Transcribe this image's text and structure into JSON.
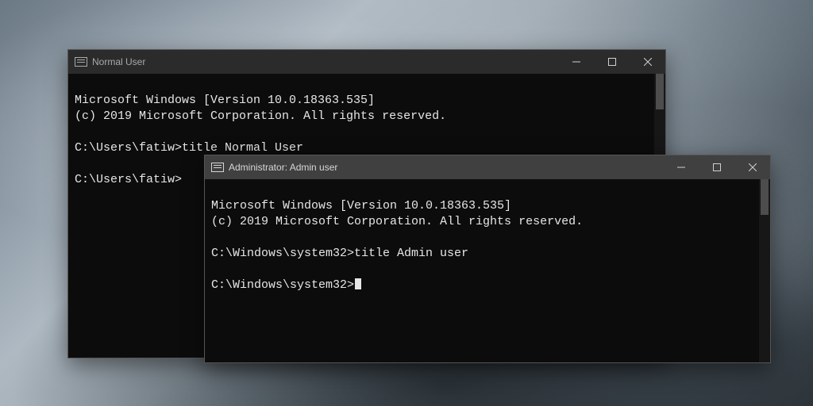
{
  "back_window": {
    "title": "Normal User",
    "lines": {
      "l1": "Microsoft Windows [Version 10.0.18363.535]",
      "l2": "(c) 2019 Microsoft Corporation. All rights reserved.",
      "blank1": "",
      "prompt1": "C:\\Users\\fatiw>title Normal User",
      "blank2": "",
      "prompt2": "C:\\Users\\fatiw>"
    }
  },
  "front_window": {
    "title": "Administrator:  Admin user",
    "lines": {
      "l1": "Microsoft Windows [Version 10.0.18363.535]",
      "l2": "(c) 2019 Microsoft Corporation. All rights reserved.",
      "blank1": "",
      "prompt1": "C:\\Windows\\system32>title Admin user",
      "blank2": "",
      "prompt2": "C:\\Windows\\system32>"
    }
  }
}
